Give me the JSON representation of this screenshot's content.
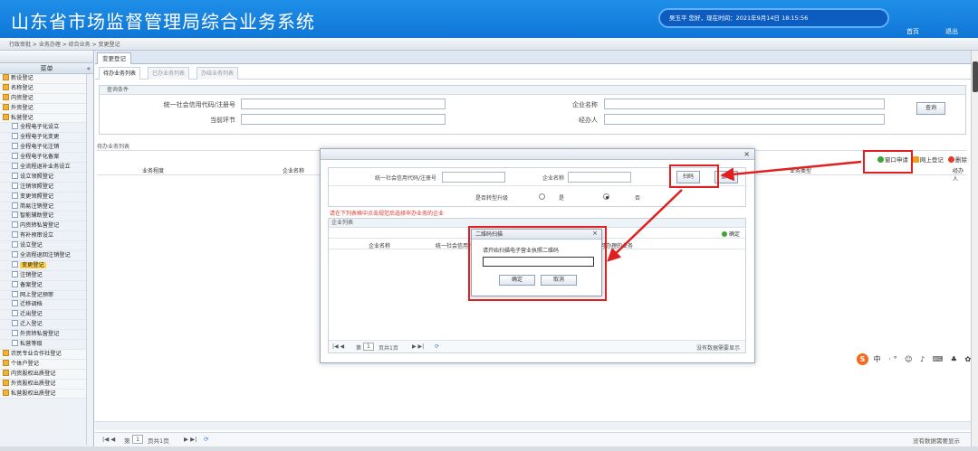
{
  "header": {
    "title": "山东省市场监督管理局综合业务系统",
    "welcome": "吴玉平 您好，现在时间：2021年9月14日 18:15:56",
    "home_label": "首页",
    "logout_label": "退出"
  },
  "nav": {
    "breadcrumb": "行政审批 > 业务办理 > 综合业务 > 变更登记"
  },
  "sidebar": {
    "menu_title": "菜单",
    "items": [
      {
        "label": "新设登记",
        "type": "group"
      },
      {
        "label": "名称登记",
        "type": "group"
      },
      {
        "label": "内资登记",
        "type": "group"
      },
      {
        "label": "外资登记",
        "type": "group"
      },
      {
        "label": "私营登记",
        "type": "group"
      },
      {
        "label": "全程电子化设立",
        "type": "sub"
      },
      {
        "label": "全程电子化变更",
        "type": "sub"
      },
      {
        "label": "全程电子化注销",
        "type": "sub"
      },
      {
        "label": "全程电子化备案",
        "type": "sub"
      },
      {
        "label": "全流程退补业务设立",
        "type": "sub"
      },
      {
        "label": "设立领照登记",
        "type": "sub"
      },
      {
        "label": "注销领照登记",
        "type": "sub"
      },
      {
        "label": "变更领照登记",
        "type": "sub"
      },
      {
        "label": "简易注销登记",
        "type": "sub"
      },
      {
        "label": "智能辅助登记",
        "type": "sub"
      },
      {
        "label": "内资转私营登记",
        "type": "sub"
      },
      {
        "label": "有补预审设立",
        "type": "sub"
      },
      {
        "label": "设立登记",
        "type": "sub"
      },
      {
        "label": "全流程退回注销登记",
        "type": "sub"
      },
      {
        "label": "变更登记",
        "type": "sub",
        "active": true
      },
      {
        "label": "注销登记",
        "type": "sub"
      },
      {
        "label": "备案登记",
        "type": "sub"
      },
      {
        "label": "网上登记预审",
        "type": "sub"
      },
      {
        "label": "迁移调档",
        "type": "sub"
      },
      {
        "label": "迁出登记",
        "type": "sub"
      },
      {
        "label": "迁入登记",
        "type": "sub"
      },
      {
        "label": "外资转私营登记",
        "type": "sub"
      },
      {
        "label": "私营等级",
        "type": "sub"
      },
      {
        "label": "农民专业合作社登记",
        "type": "group"
      },
      {
        "label": "个体户登记",
        "type": "group"
      },
      {
        "label": "内资股权出质登记",
        "type": "group"
      },
      {
        "label": "外资股权出质登记",
        "type": "group"
      },
      {
        "label": "私营股权出质登记",
        "type": "group"
      }
    ]
  },
  "main": {
    "tab": "变更登记",
    "subtabs": [
      "待办业务列表",
      "已办业务列表",
      "办结业务列表"
    ],
    "query": {
      "caption": "查询条件",
      "uscc_label": "统一社会信用代码/注册号",
      "company_label": "企业名称",
      "stage_label": "当前环节",
      "handler_label": "经办人",
      "search_button": "查询"
    },
    "list_caption": "待办业务列表",
    "columns": [
      "业务程度",
      "企业名称",
      "业务类型",
      "经办人"
    ],
    "toolbar": {
      "window_apply": "窗口申请",
      "online_register": "网上登记",
      "delete": "删除"
    },
    "pager": {
      "page_prefix": "第",
      "page_value": "1",
      "page_suffix": "页共1页",
      "no_records": "没有数据需要显示"
    }
  },
  "dialog_select": {
    "uscc_label": "统一社会信用代码/注册号",
    "company_label": "企业名称",
    "scan_button": "扫码",
    "search_button": "查询",
    "upgrade_label": "是否转型升级",
    "yes_label": "是",
    "no_label": "否",
    "upgrade_selected": "否",
    "warning": "请在下列表格中点击规范后选择申办业务的企业",
    "list_caption": "企业列表",
    "confirm_label": "确定",
    "columns": [
      "企业名称",
      "统一社会信用代码",
      "可办理的业务"
    ],
    "pager": {
      "page_prefix": "第",
      "page_value": "1",
      "page_suffix": "页共1页",
      "no_records": "没有数据需要显示"
    }
  },
  "dialog_qr": {
    "title": "二维码扫描",
    "prompt": "请开始扫描电子营业执照二维码",
    "input_value": "",
    "confirm": "确定",
    "cancel": "取消"
  },
  "colors": {
    "header_blue": "#1585e0",
    "highlight_red": "#e02020",
    "active_menu": "#ffd34d"
  }
}
